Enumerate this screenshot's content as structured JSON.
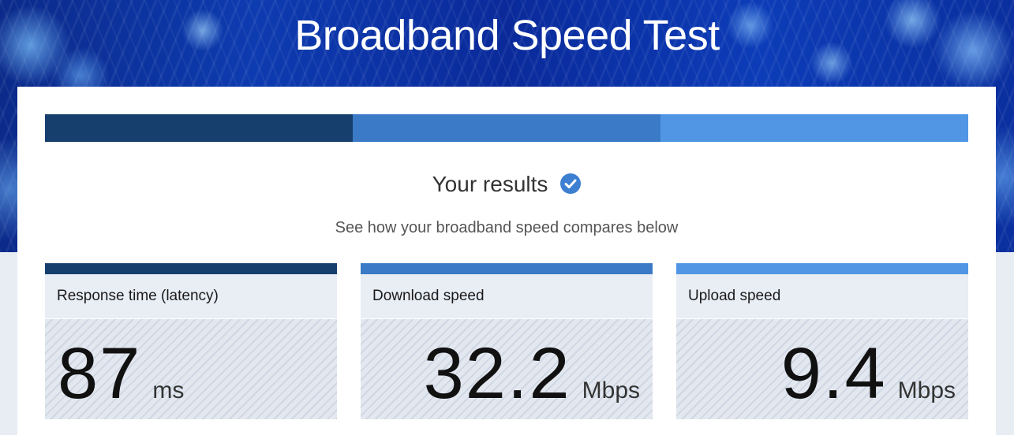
{
  "page": {
    "title": "Broadband Speed Test"
  },
  "progress": {
    "segment_colors": [
      "#173f6e",
      "#3a7ac6",
      "#5096e4"
    ]
  },
  "results": {
    "heading": "Your results",
    "check_icon": "check-circle-icon",
    "check_color": "#3d7fd0",
    "subtitle": "See how your broadband speed compares below"
  },
  "metrics": [
    {
      "label": "Response time (latency)",
      "value": "87",
      "unit": "ms",
      "bar_color": "#173f6e"
    },
    {
      "label": "Download speed",
      "value": "32.2",
      "unit": "Mbps",
      "bar_color": "#3a7ac6"
    },
    {
      "label": "Upload speed",
      "value": "9.4",
      "unit": "Mbps",
      "bar_color": "#5096e4"
    }
  ]
}
